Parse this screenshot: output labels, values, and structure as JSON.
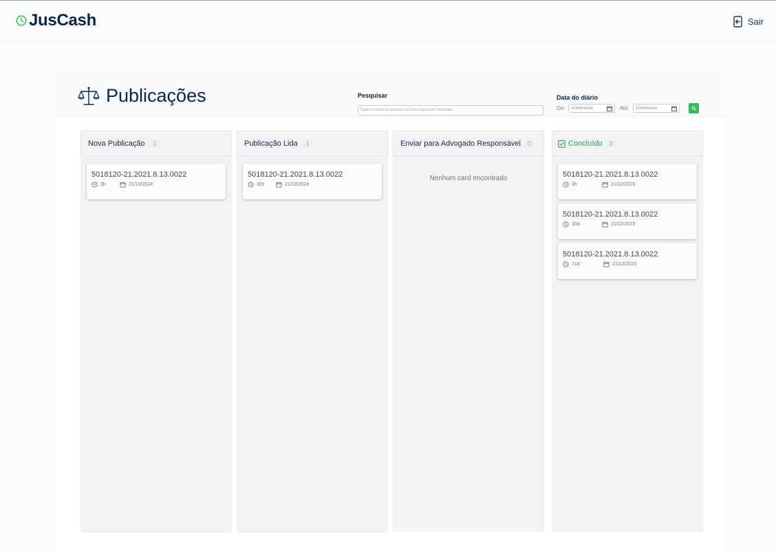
{
  "app": {
    "brand": "JusCash",
    "logout_label": "Sair"
  },
  "page": {
    "title": "Publicações"
  },
  "search": {
    "label": "Pesquisar",
    "placeholder": "Digite o número do processo ou nome das partes envolvidas"
  },
  "date_filter": {
    "label": "Data do diário",
    "from_label": "De:",
    "to_label": "Até:",
    "from_placeholder": "DD/MM/AAAA",
    "to_placeholder": "DD/MM/AAAA"
  },
  "colors": {
    "accent_green": "#2fbf58",
    "brand_navy": "#0b2447"
  },
  "columns": [
    {
      "title": "Nova Publicação",
      "count": "1",
      "cards": [
        {
          "process": "5018120-21.2021.8.13.0022",
          "elapsed": "3h",
          "date": "21/10/2024"
        }
      ]
    },
    {
      "title": "Publicação Lida",
      "count": "1",
      "cards": [
        {
          "process": "5018120-21.2021.8.13.0022",
          "elapsed": "30s",
          "date": "21/10/2024"
        }
      ]
    },
    {
      "title": "Enviar para Advogado Responsável",
      "count": "0",
      "empty_message": "Nenhum card encontrado",
      "cards": []
    },
    {
      "title": "Concluído",
      "count": "3",
      "icon": "checkbox-icon",
      "cards": [
        {
          "process": "5018120-21.2021.8.13.0022",
          "elapsed": "3h",
          "date": "21/12/2023"
        },
        {
          "process": "5018120-21.2021.8.13.0022",
          "elapsed": "30d",
          "date": "21/12/2023"
        },
        {
          "process": "5018120-21.2021.8.13.0022",
          "elapsed": "71d",
          "date": "21/12/2023"
        }
      ]
    }
  ]
}
